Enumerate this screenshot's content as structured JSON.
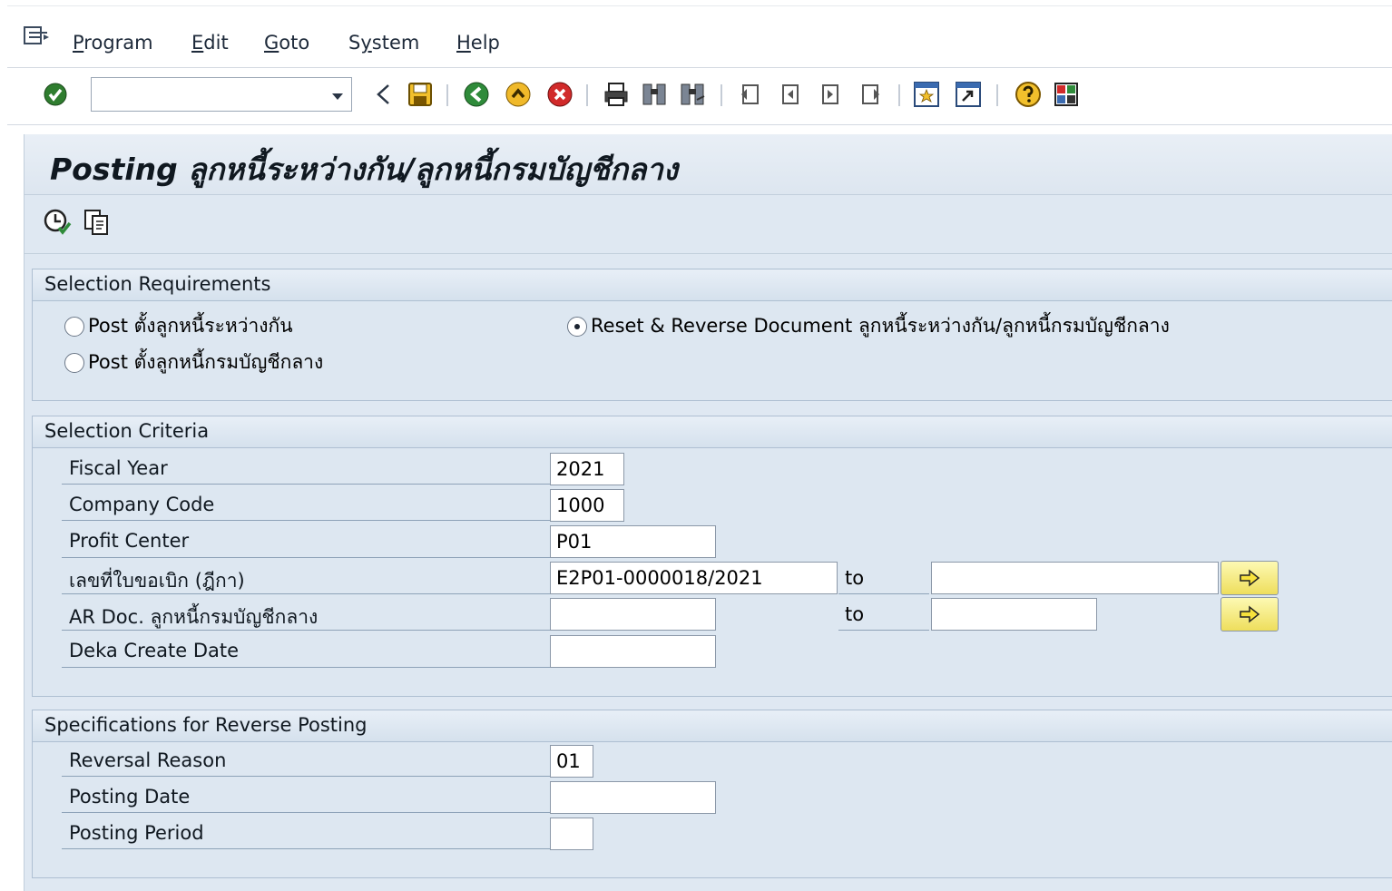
{
  "menu": {
    "items": [
      {
        "label": "Program",
        "accel": "P",
        "rest": "rogram"
      },
      {
        "label": "Edit",
        "accel": "E",
        "rest": "dit"
      },
      {
        "label": "Goto",
        "accel": "G",
        "rest": "oto"
      },
      {
        "label": "System",
        "accel": "y",
        "pre": "S",
        "rest": "stem"
      },
      {
        "label": "Help",
        "accel": "H",
        "rest": "elp"
      }
    ]
  },
  "toolbar": {
    "command_field_value": "",
    "icons": [
      "enter-check-icon",
      "back-triangle-icon",
      "save-icon",
      "back-icon",
      "exit-icon",
      "cancel-icon",
      "print-icon",
      "find-icon",
      "find-next-icon",
      "first-page-icon",
      "previous-page-icon",
      "next-page-icon",
      "last-page-icon",
      "create-session-icon",
      "shortcut-icon",
      "help-icon",
      "customize-layout-icon"
    ]
  },
  "page": {
    "title": "Posting ลูกหนี้ระหว่างกัน/ลูกหนี้กรมบัญชีกลาง"
  },
  "app_toolbar": {
    "icons": [
      "execute-icon",
      "get-variant-icon"
    ]
  },
  "selection_requirements": {
    "header": "Selection Requirements",
    "options": [
      {
        "label": "Post ตั้งลูกหนี้ระหว่างกัน",
        "selected": false
      },
      {
        "label": "Post ตั้งลูกหนี้กรมบัญชีกลาง",
        "selected": false
      },
      {
        "label": "Reset & Reverse Document ลูกหนี้ระหว่างกัน/ลูกหนี้กรมบัญชีกลาง",
        "selected": true
      }
    ]
  },
  "selection_criteria": {
    "header": "Selection Criteria",
    "to_label": "to",
    "fields": [
      {
        "label": "Fiscal Year",
        "value": "2021"
      },
      {
        "label": "Company Code",
        "value": "1000"
      },
      {
        "label": "Profit Center",
        "value": "P01"
      },
      {
        "label": "เลขที่ใบขอเบิก (ฎีกา)",
        "value": "E2P01-0000018/2021",
        "to_value": ""
      },
      {
        "label": "AR Doc. ลูกหนี้กรมบัญชีกลาง",
        "value": "",
        "to_value": ""
      },
      {
        "label": "Deka Create Date",
        "value": ""
      }
    ]
  },
  "reverse_posting": {
    "header": "Specifications for Reverse Posting",
    "fields": [
      {
        "label": "Reversal Reason",
        "value": "01"
      },
      {
        "label": "Posting Date",
        "value": ""
      },
      {
        "label": "Posting Period",
        "value": ""
      }
    ]
  },
  "colors": {
    "background": "#dfe8f2",
    "more_button": "#f4e97a",
    "group_border": "#aebfd2"
  }
}
